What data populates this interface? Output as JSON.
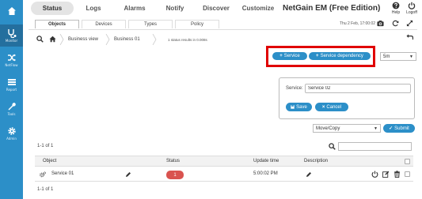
{
  "colors": {
    "primary": "#2c8fc8",
    "sidebar_active": "#246f9e",
    "danger": "#d9534f",
    "highlight": "#e00000"
  },
  "sidebar": {
    "items": [
      {
        "label": "",
        "icon": "dashboard-icon"
      },
      {
        "label": "Monitor",
        "icon": "stethoscope-icon"
      },
      {
        "label": "NetFlow",
        "icon": "shuffle-icon"
      },
      {
        "label": "Report",
        "icon": "list-icon"
      },
      {
        "label": "Tools",
        "icon": "wrench-icon"
      },
      {
        "label": "Admin",
        "icon": "gear-icon"
      }
    ]
  },
  "topnav": {
    "tabs": [
      "Status",
      "Logs",
      "Alarms",
      "Notify",
      "Discover",
      "Customize"
    ],
    "brand": "NetGain EM (Free Edition)",
    "help_label": "Help",
    "logoff_label": "Logoff"
  },
  "subtabs": [
    "Objects",
    "Devices",
    "Types",
    "Policy"
  ],
  "header": {
    "datetime": "Thu 2 Feb, 17:00:02"
  },
  "breadcrumb": {
    "items": [
      "Business view",
      "Business 01"
    ],
    "status": "1 status results in 0.008s"
  },
  "actions": {
    "add_service": "Service",
    "add_dependency": "Service dependency",
    "interval": "5m"
  },
  "service_form": {
    "label": "Service:",
    "value": "Service 02",
    "save": "Save",
    "cancel": "Cancel"
  },
  "bulk": {
    "action": "Move/Copy",
    "submit": "Submit"
  },
  "table": {
    "count_top": "1-1 of 1",
    "count_bottom": "1-1 of 1",
    "columns": [
      "Object",
      "Status",
      "Update time",
      "Description"
    ],
    "rows": [
      {
        "object": "Service 01",
        "status": "1",
        "update_time": "5:00:02 PM"
      }
    ]
  }
}
